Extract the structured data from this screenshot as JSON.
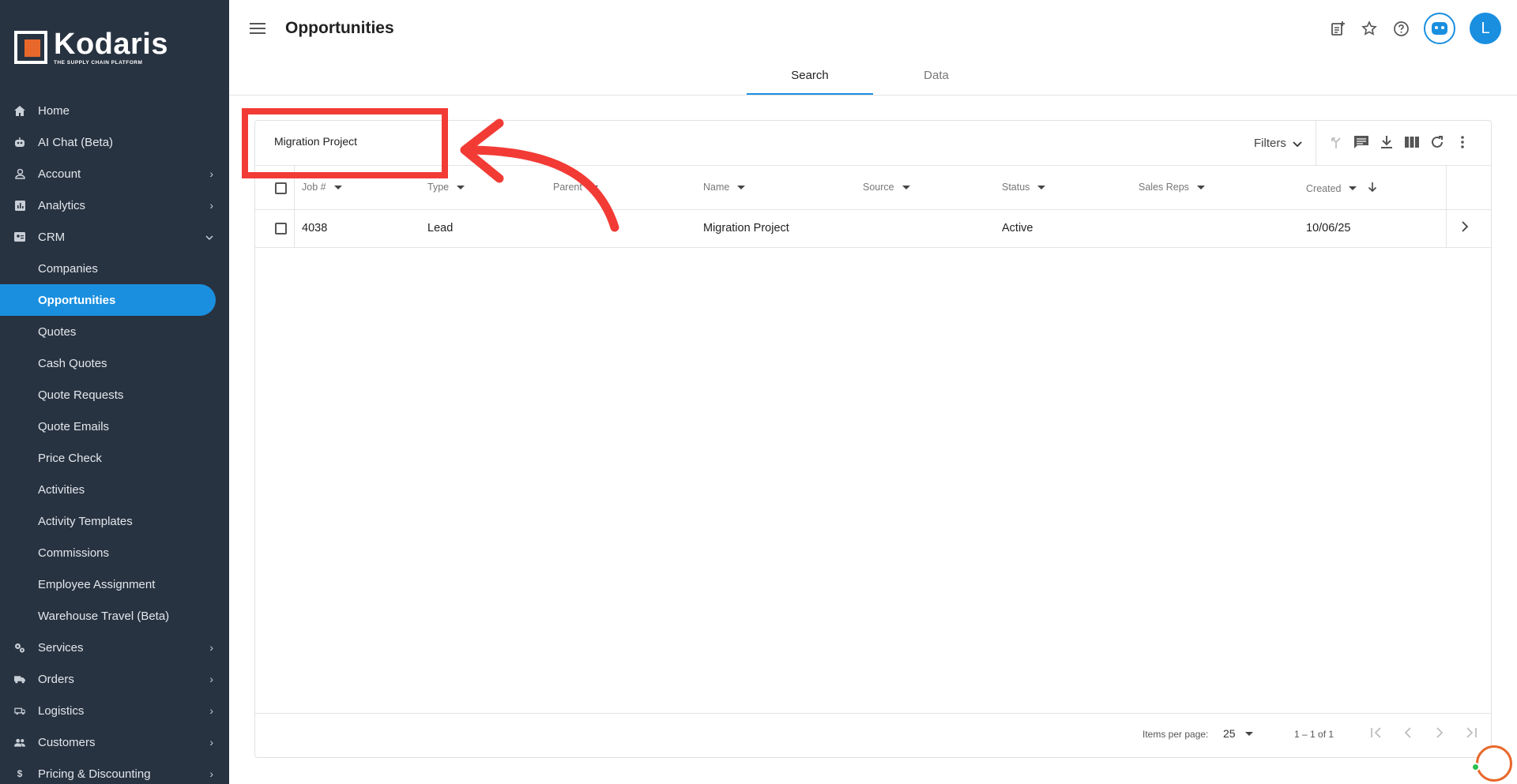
{
  "brand": {
    "name": "Kodaris",
    "tagline": "THE SUPPLY CHAIN PLATFORM"
  },
  "sidebar": {
    "items": [
      {
        "label": "Home",
        "icon": "home-icon",
        "chevron": false
      },
      {
        "label": "AI Chat (Beta)",
        "icon": "robot-icon",
        "chevron": false
      },
      {
        "label": "Account",
        "icon": "person-icon",
        "chevron": true
      },
      {
        "label": "Analytics",
        "icon": "analytics-icon",
        "chevron": true
      },
      {
        "label": "CRM",
        "icon": "contact-card-icon",
        "chevron": "down"
      },
      {
        "label": "Companies",
        "sub": true
      },
      {
        "label": "Opportunities",
        "sub": true,
        "active": true
      },
      {
        "label": "Quotes",
        "sub": true
      },
      {
        "label": "Cash Quotes",
        "sub": true
      },
      {
        "label": "Quote Requests",
        "sub": true
      },
      {
        "label": "Quote Emails",
        "sub": true
      },
      {
        "label": "Price Check",
        "sub": true
      },
      {
        "label": "Activities",
        "sub": true
      },
      {
        "label": "Activity Templates",
        "sub": true
      },
      {
        "label": "Commissions",
        "sub": true
      },
      {
        "label": "Employee Assignment",
        "sub": true
      },
      {
        "label": "Warehouse Travel (Beta)",
        "sub": true
      },
      {
        "label": "Services",
        "icon": "gears-icon",
        "chevron": true
      },
      {
        "label": "Orders",
        "icon": "truck-icon",
        "chevron": true
      },
      {
        "label": "Logistics",
        "icon": "shipping-icon",
        "chevron": true
      },
      {
        "label": "Customers",
        "icon": "people-icon",
        "chevron": true
      },
      {
        "label": "Pricing & Discounting",
        "icon": "dollar-icon",
        "chevron": true
      }
    ]
  },
  "header": {
    "title": "Opportunities",
    "avatar_initial": "L"
  },
  "tabs": [
    {
      "label": "Search",
      "active": true
    },
    {
      "label": "Data",
      "active": false
    }
  ],
  "search": {
    "value": "Migration Project"
  },
  "toolbar": {
    "filters_label": "Filters"
  },
  "table": {
    "columns": [
      "Job #",
      "Type",
      "Parent",
      "Name",
      "Source",
      "Status",
      "Sales Reps",
      "Created"
    ],
    "rows": [
      {
        "job": "4038",
        "type": "Lead",
        "parent": "",
        "name": "Migration Project",
        "source": "",
        "status": "Active",
        "sales_reps": "",
        "created": "10/06/25"
      }
    ]
  },
  "pagination": {
    "items_per_page_label": "Items per page:",
    "items_per_page": "25",
    "range": "1 – 1 of 1"
  },
  "colors": {
    "accent": "#1a8fe0",
    "sidebar_bg": "#283341",
    "annotation": "#f23b35",
    "brand_orange": "#e8682b"
  }
}
